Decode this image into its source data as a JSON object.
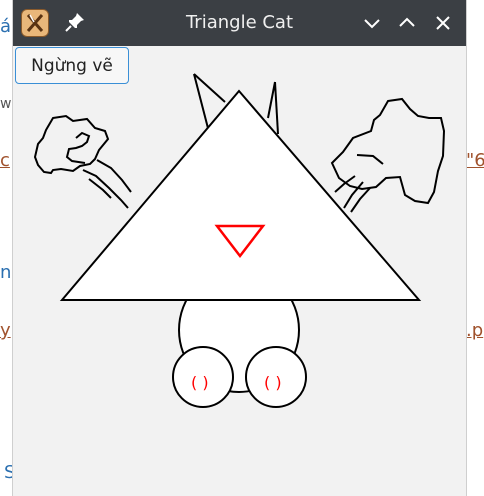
{
  "window": {
    "title": "Triangle Cat",
    "app_icon": "x-logo-icon",
    "pin_icon": "pin-icon",
    "controls": [
      "minimize-chevron-icon",
      "maximize-chevron-icon",
      "close-icon"
    ]
  },
  "toolbar": {
    "stop_label": "Ngừng vẽ"
  },
  "background": {
    "fragments": [
      "ár",
      "w",
      "c",
      "\"6",
      "n",
      "y",
      ".p",
      "S"
    ]
  },
  "drawing": {
    "stroke_color": "#000000",
    "nose_color": "#ff0000",
    "paw_marks": [
      "( )",
      "( )"
    ]
  }
}
